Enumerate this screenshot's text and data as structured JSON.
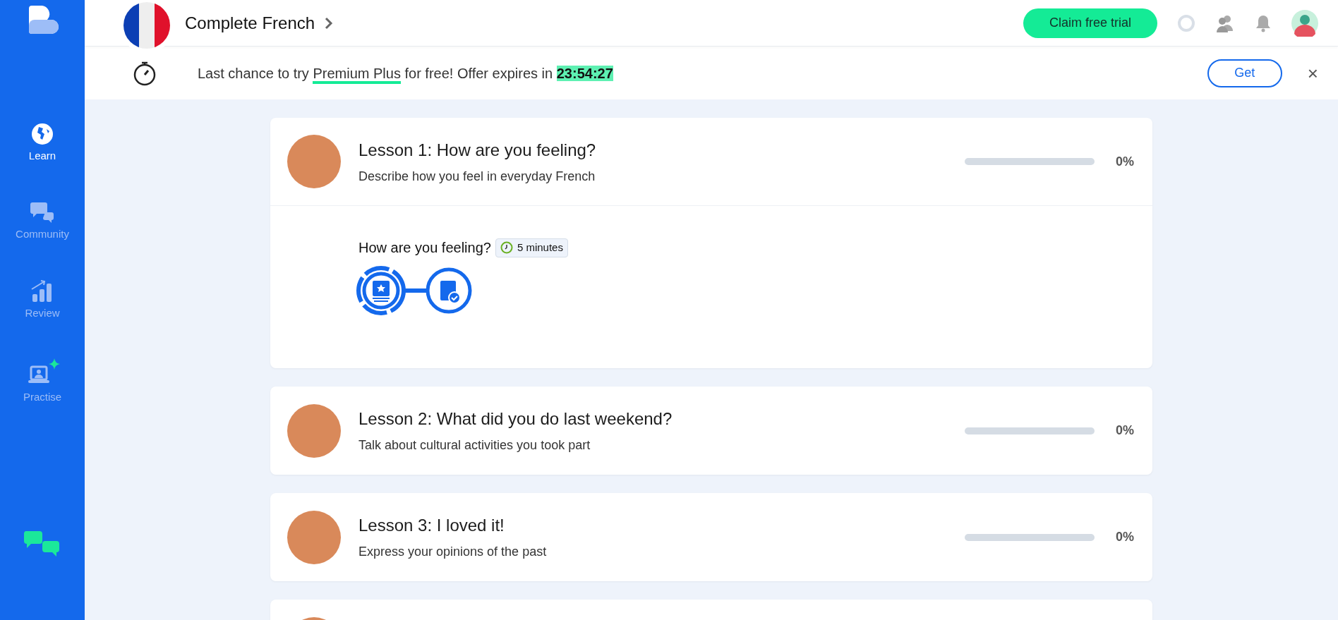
{
  "sidebar": {
    "items": [
      {
        "kind": "learn",
        "label": "Learn",
        "selected": true
      },
      {
        "kind": "community",
        "label": "Community",
        "selected": false
      },
      {
        "kind": "review",
        "label": "Review",
        "selected": false
      },
      {
        "kind": "practise",
        "label": "Practise",
        "selected": false
      }
    ]
  },
  "header": {
    "course": "Complete French",
    "trial_button": "Claim free trial"
  },
  "banner": {
    "text_before": "Last chance to try ",
    "highlight": "Premium Plus",
    "text_after": " for free! Offer expires in ",
    "timer": "23:54:27",
    "button": "Get",
    "close": "×"
  },
  "lessons": [
    {
      "title": "Lesson 1: How are you feeling?",
      "subtitle": "Describe how you feel in everyday French",
      "level": 0,
      "reading": "0%",
      "expanded": true,
      "activity": {
        "title": "How are you feeling?",
        "duration": "5 minutes",
        "steps": [
          {
            "kind": "flashcard",
            "selected": true
          },
          {
            "kind": "book",
            "selected": false
          }
        ]
      }
    },
    {
      "title": "Lesson 2: What did you do last weekend?",
      "subtitle": "Talk about cultural activities you took part",
      "level": 0,
      "reading": "0%",
      "expanded": false
    },
    {
      "title": "Lesson 3: I loved it!",
      "subtitle": "Express your opinions of the past",
      "level": 0,
      "reading": "0%",
      "expanded": false
    },
    {
      "expanded": false
    }
  ]
}
